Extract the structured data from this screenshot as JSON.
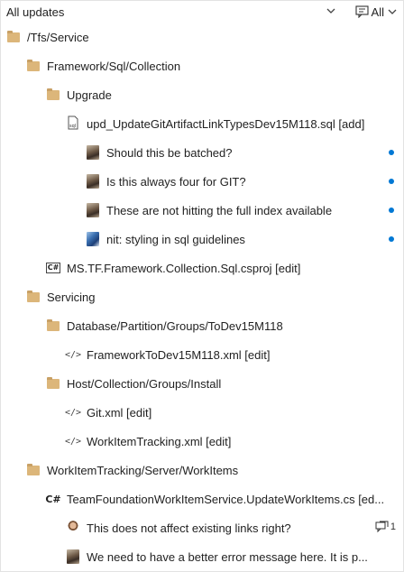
{
  "header": {
    "title": "All updates",
    "filter_label": "All"
  },
  "tree": [
    {
      "kind": "folder",
      "icon": "folder-icon",
      "indent": 0,
      "label": "/Tfs/Service"
    },
    {
      "kind": "folder",
      "icon": "folder-icon",
      "indent": 1,
      "label": "Framework/Sql/Collection"
    },
    {
      "kind": "folder",
      "icon": "folder-icon",
      "indent": 2,
      "label": "Upgrade"
    },
    {
      "kind": "file",
      "icon": "sql-file-icon",
      "glyph": "sql",
      "indent": 3,
      "label": "upd_UpdateGitArtifactLinkTypesDev15M118.sql [add]"
    },
    {
      "kind": "comment",
      "icon": "avatar",
      "avatar": "av1",
      "indent": 4,
      "label": "Should this be batched?",
      "unread": true
    },
    {
      "kind": "comment",
      "icon": "avatar",
      "avatar": "av1",
      "indent": 4,
      "label": "Is this always four for GIT?",
      "unread": true
    },
    {
      "kind": "comment",
      "icon": "avatar",
      "avatar": "av1",
      "indent": 4,
      "label": "These are not hitting the full index available",
      "unread": true
    },
    {
      "kind": "comment",
      "icon": "avatar",
      "avatar": "av2",
      "indent": 4,
      "label": "nit: styling in sql guidelines",
      "unread": true
    },
    {
      "kind": "file",
      "icon": "csproj-file-icon",
      "glyph": "C#",
      "indent": 2,
      "label": "MS.TF.Framework.Collection.Sql.csproj [edit]"
    },
    {
      "kind": "folder",
      "icon": "folder-icon",
      "indent": 1,
      "label": "Servicing"
    },
    {
      "kind": "folder",
      "icon": "folder-icon",
      "indent": 2,
      "label": "Database/Partition/Groups/ToDev15M118"
    },
    {
      "kind": "file",
      "icon": "xml-file-icon",
      "glyph": "</>",
      "indent": 3,
      "label": "FrameworkToDev15M118.xml [edit]"
    },
    {
      "kind": "folder",
      "icon": "folder-icon",
      "indent": 2,
      "label": "Host/Collection/Groups/Install"
    },
    {
      "kind": "file",
      "icon": "xml-file-icon",
      "glyph": "</>",
      "indent": 3,
      "label": "Git.xml [edit]"
    },
    {
      "kind": "file",
      "icon": "xml-file-icon",
      "glyph": "</>",
      "indent": 3,
      "label": "WorkItemTracking.xml [edit]"
    },
    {
      "kind": "folder",
      "icon": "folder-icon",
      "indent": 1,
      "label": "WorkItemTracking/Server/WorkItems"
    },
    {
      "kind": "file",
      "icon": "csharp-file-icon",
      "glyph": "C#",
      "indent": 2,
      "label": "TeamFoundationWorkItemService.UpdateWorkItems.cs [ed..."
    },
    {
      "kind": "comment",
      "icon": "avatar",
      "avatar": "av3",
      "indent": 3,
      "label": "This does not affect existing links right?",
      "replies": "1"
    },
    {
      "kind": "comment",
      "icon": "avatar",
      "avatar": "av1",
      "indent": 3,
      "label": "We need to have a better error message here. It is p..."
    }
  ],
  "colors": {
    "folder": "#dcb67a",
    "unread_dot": "#0078d4",
    "border": "#e3e3e3"
  }
}
